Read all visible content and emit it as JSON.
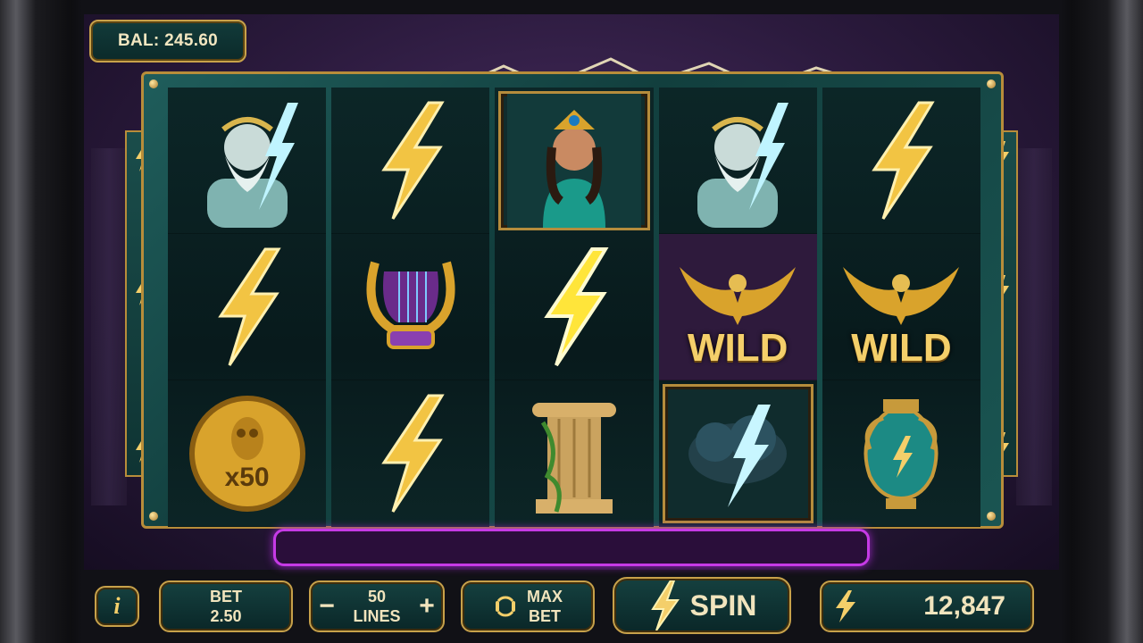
{
  "balance": {
    "label": "BAL: 245.60"
  },
  "reels": [
    [
      "zeus",
      "lightning-bolt",
      "owl-coin"
    ],
    [
      "lightning-bolt",
      "lyre",
      "lightning-bolt"
    ],
    [
      "goddess-portrait",
      "lightning-bolt-bright",
      "ionic-column"
    ],
    [
      "zeus",
      "eagle-wild",
      "storm-cloud"
    ],
    [
      "lightning-bolt",
      "eagle-wild",
      "amphora"
    ]
  ],
  "symbols": {
    "wild_label": "WILD",
    "coin_multiplier": "x50"
  },
  "progress": {
    "fraction": 0
  },
  "controls": {
    "info_label": "i",
    "bet_label": "BET",
    "bet_value": "2.50",
    "lines_value": "50",
    "lines_label": "LINES",
    "minus": "−",
    "plus": "+",
    "max_label": "MAX",
    "max_label2": "BET",
    "spin_label": "SPIN",
    "credits_value": "12,847"
  },
  "colors": {
    "gold": "#f4cf6a",
    "teal": "#15403f",
    "purple_bar": "#c63ae6"
  }
}
